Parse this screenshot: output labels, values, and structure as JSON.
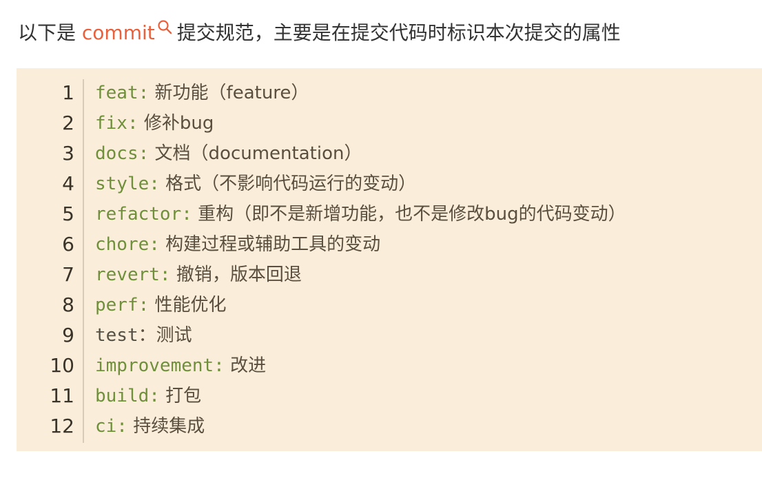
{
  "intro": {
    "prefix": "以下是 ",
    "link": "commit",
    "search_icon": "search-icon",
    "suffix": "提交规范，主要是在提交代码时标识本次提交的属性"
  },
  "code": {
    "lines": [
      {
        "num": "1",
        "key": "feat:",
        "desc": " 新功能（feature）"
      },
      {
        "num": "2",
        "key": "fix:",
        "desc": " 修补bug"
      },
      {
        "num": "3",
        "key": "docs:",
        "desc": " 文档（documentation）"
      },
      {
        "num": "4",
        "key": "style:",
        "desc": " 格式（不影响代码运行的变动）"
      },
      {
        "num": "5",
        "key": "refactor:",
        "desc": " 重构（即不是新增功能，也不是修改bug的代码变动）"
      },
      {
        "num": "6",
        "key": "chore:",
        "desc": " 构建过程或辅助工具的变动"
      },
      {
        "num": "7",
        "key": "revert:",
        "desc": " 撤销，版本回退"
      },
      {
        "num": "8",
        "key": "perf:",
        "desc": " 性能优化"
      },
      {
        "num": "9",
        "key": "test",
        "desc": "：测试"
      },
      {
        "num": "10",
        "key": "improvement:",
        "desc": " 改进"
      },
      {
        "num": "11",
        "key": "build:",
        "desc": " 打包"
      },
      {
        "num": "12",
        "key": "ci:",
        "desc": " 持续集成"
      }
    ]
  },
  "colors": {
    "link": "#e8603c",
    "code_background": "#faeedb",
    "keyword": "#6f8f3a"
  }
}
